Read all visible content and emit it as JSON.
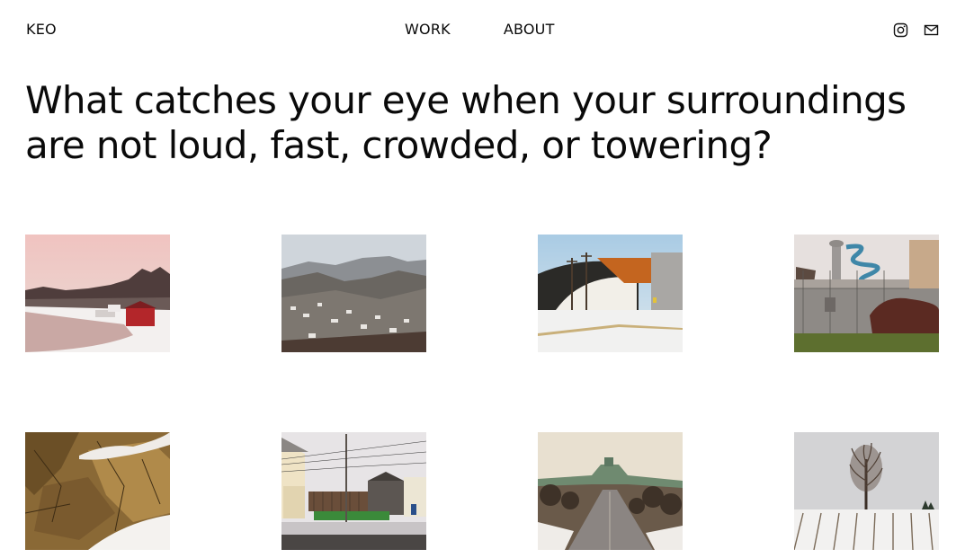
{
  "header": {
    "logo": "KEO",
    "nav": [
      {
        "label": "WORK"
      },
      {
        "label": "ABOUT"
      }
    ],
    "social_icons": [
      "instagram-icon",
      "mail-icon"
    ]
  },
  "headline": {
    "line1": "What catches your eye when your surroundings",
    "line2": "are not loud, fast, crowded, or towering?"
  },
  "gallery": [
    {
      "subject": "frozen-river-red-boathouse"
    },
    {
      "subject": "valley-town-hills"
    },
    {
      "subject": "arched-arena-building"
    },
    {
      "subject": "waterslide-tower-fence"
    },
    {
      "subject": "rocky-cliff-snow"
    },
    {
      "subject": "backyard-houses-powerlines"
    },
    {
      "subject": "street-toward-hill"
    },
    {
      "subject": "lone-tree-snowy-field"
    }
  ]
}
